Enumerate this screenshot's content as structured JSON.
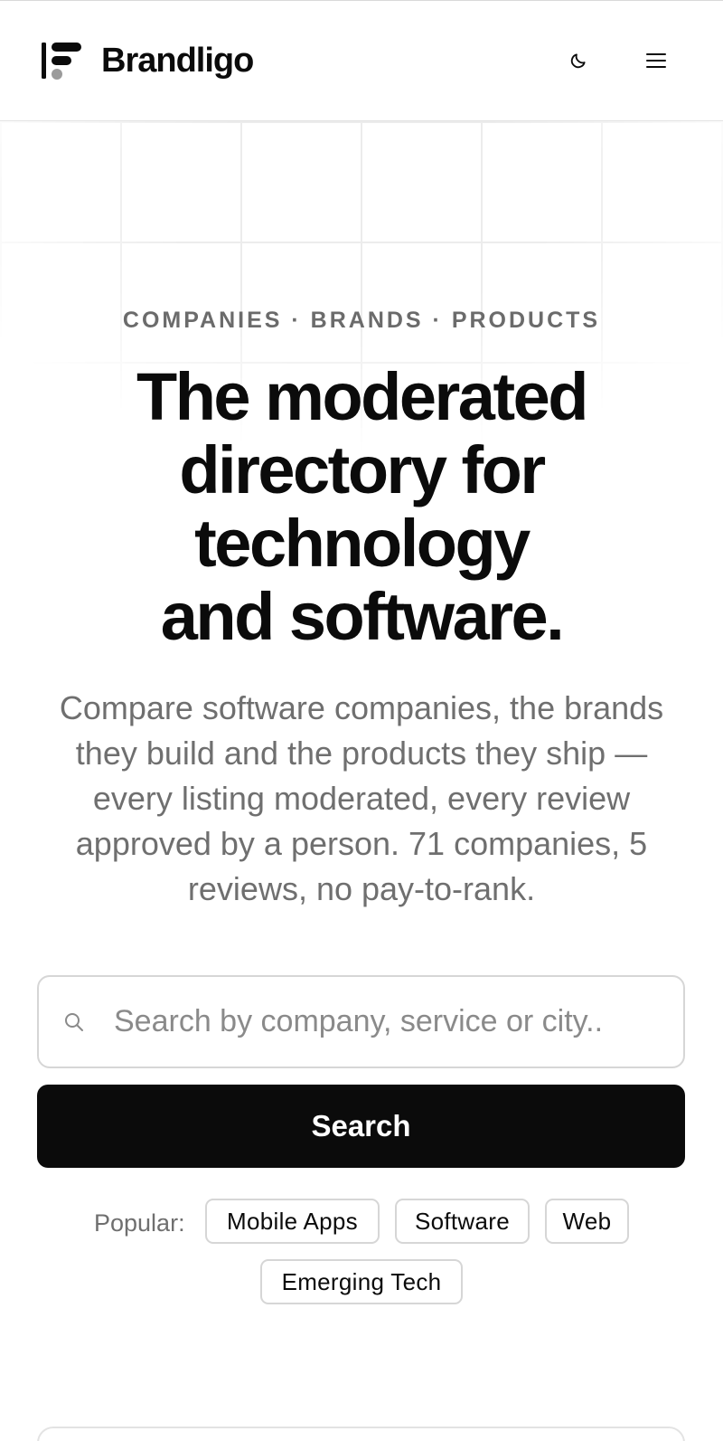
{
  "brand": {
    "name": "Brandligo"
  },
  "header": {
    "theme_toggle_icon": "moon-icon",
    "menu_icon": "hamburger-menu-icon"
  },
  "hero": {
    "eyebrow": "COMPANIES · BRANDS · PRODUCTS",
    "headline_lines": [
      "The moderated",
      "directory for",
      "technology",
      "and software."
    ],
    "subtext": "Compare software companies, the brands they build and the products they ship — every listing moderated, every review approved by a person. 71 companies, 5 reviews, no pay-to-rank."
  },
  "search": {
    "placeholder": "Search by company, service or city..",
    "value": "",
    "icon": "search-icon",
    "button_label": "Search"
  },
  "popular": {
    "label": "Popular:",
    "chips": [
      "Mobile Apps",
      "Software",
      "Web",
      "Emerging Tech"
    ]
  },
  "colors": {
    "accent": "#0b0b0b",
    "muted_text": "#6f6f6f",
    "border": "#d6d6d6",
    "logo_gray": "#9b9b9b"
  }
}
